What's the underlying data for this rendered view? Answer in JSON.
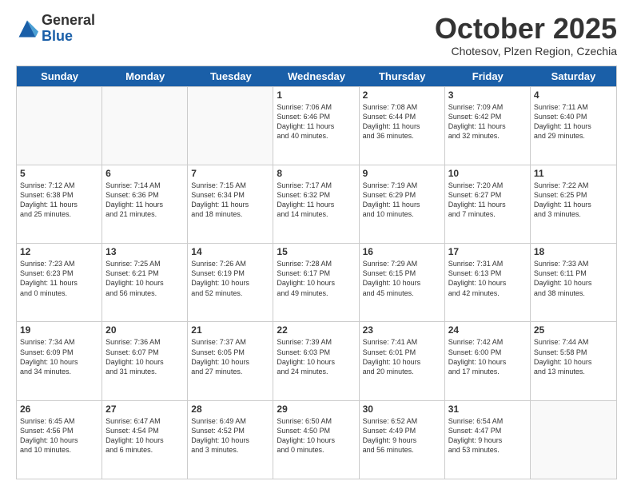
{
  "logo": {
    "general": "General",
    "blue": "Blue"
  },
  "header": {
    "month": "October 2025",
    "location": "Chotesov, Plzen Region, Czechia"
  },
  "weekdays": [
    "Sunday",
    "Monday",
    "Tuesday",
    "Wednesday",
    "Thursday",
    "Friday",
    "Saturday"
  ],
  "rows": [
    [
      {
        "day": "",
        "info": ""
      },
      {
        "day": "",
        "info": ""
      },
      {
        "day": "",
        "info": ""
      },
      {
        "day": "1",
        "info": "Sunrise: 7:06 AM\nSunset: 6:46 PM\nDaylight: 11 hours\nand 40 minutes."
      },
      {
        "day": "2",
        "info": "Sunrise: 7:08 AM\nSunset: 6:44 PM\nDaylight: 11 hours\nand 36 minutes."
      },
      {
        "day": "3",
        "info": "Sunrise: 7:09 AM\nSunset: 6:42 PM\nDaylight: 11 hours\nand 32 minutes."
      },
      {
        "day": "4",
        "info": "Sunrise: 7:11 AM\nSunset: 6:40 PM\nDaylight: 11 hours\nand 29 minutes."
      }
    ],
    [
      {
        "day": "5",
        "info": "Sunrise: 7:12 AM\nSunset: 6:38 PM\nDaylight: 11 hours\nand 25 minutes."
      },
      {
        "day": "6",
        "info": "Sunrise: 7:14 AM\nSunset: 6:36 PM\nDaylight: 11 hours\nand 21 minutes."
      },
      {
        "day": "7",
        "info": "Sunrise: 7:15 AM\nSunset: 6:34 PM\nDaylight: 11 hours\nand 18 minutes."
      },
      {
        "day": "8",
        "info": "Sunrise: 7:17 AM\nSunset: 6:32 PM\nDaylight: 11 hours\nand 14 minutes."
      },
      {
        "day": "9",
        "info": "Sunrise: 7:19 AM\nSunset: 6:29 PM\nDaylight: 11 hours\nand 10 minutes."
      },
      {
        "day": "10",
        "info": "Sunrise: 7:20 AM\nSunset: 6:27 PM\nDaylight: 11 hours\nand 7 minutes."
      },
      {
        "day": "11",
        "info": "Sunrise: 7:22 AM\nSunset: 6:25 PM\nDaylight: 11 hours\nand 3 minutes."
      }
    ],
    [
      {
        "day": "12",
        "info": "Sunrise: 7:23 AM\nSunset: 6:23 PM\nDaylight: 11 hours\nand 0 minutes."
      },
      {
        "day": "13",
        "info": "Sunrise: 7:25 AM\nSunset: 6:21 PM\nDaylight: 10 hours\nand 56 minutes."
      },
      {
        "day": "14",
        "info": "Sunrise: 7:26 AM\nSunset: 6:19 PM\nDaylight: 10 hours\nand 52 minutes."
      },
      {
        "day": "15",
        "info": "Sunrise: 7:28 AM\nSunset: 6:17 PM\nDaylight: 10 hours\nand 49 minutes."
      },
      {
        "day": "16",
        "info": "Sunrise: 7:29 AM\nSunset: 6:15 PM\nDaylight: 10 hours\nand 45 minutes."
      },
      {
        "day": "17",
        "info": "Sunrise: 7:31 AM\nSunset: 6:13 PM\nDaylight: 10 hours\nand 42 minutes."
      },
      {
        "day": "18",
        "info": "Sunrise: 7:33 AM\nSunset: 6:11 PM\nDaylight: 10 hours\nand 38 minutes."
      }
    ],
    [
      {
        "day": "19",
        "info": "Sunrise: 7:34 AM\nSunset: 6:09 PM\nDaylight: 10 hours\nand 34 minutes."
      },
      {
        "day": "20",
        "info": "Sunrise: 7:36 AM\nSunset: 6:07 PM\nDaylight: 10 hours\nand 31 minutes."
      },
      {
        "day": "21",
        "info": "Sunrise: 7:37 AM\nSunset: 6:05 PM\nDaylight: 10 hours\nand 27 minutes."
      },
      {
        "day": "22",
        "info": "Sunrise: 7:39 AM\nSunset: 6:03 PM\nDaylight: 10 hours\nand 24 minutes."
      },
      {
        "day": "23",
        "info": "Sunrise: 7:41 AM\nSunset: 6:01 PM\nDaylight: 10 hours\nand 20 minutes."
      },
      {
        "day": "24",
        "info": "Sunrise: 7:42 AM\nSunset: 6:00 PM\nDaylight: 10 hours\nand 17 minutes."
      },
      {
        "day": "25",
        "info": "Sunrise: 7:44 AM\nSunset: 5:58 PM\nDaylight: 10 hours\nand 13 minutes."
      }
    ],
    [
      {
        "day": "26",
        "info": "Sunrise: 6:45 AM\nSunset: 4:56 PM\nDaylight: 10 hours\nand 10 minutes."
      },
      {
        "day": "27",
        "info": "Sunrise: 6:47 AM\nSunset: 4:54 PM\nDaylight: 10 hours\nand 6 minutes."
      },
      {
        "day": "28",
        "info": "Sunrise: 6:49 AM\nSunset: 4:52 PM\nDaylight: 10 hours\nand 3 minutes."
      },
      {
        "day": "29",
        "info": "Sunrise: 6:50 AM\nSunset: 4:50 PM\nDaylight: 10 hours\nand 0 minutes."
      },
      {
        "day": "30",
        "info": "Sunrise: 6:52 AM\nSunset: 4:49 PM\nDaylight: 9 hours\nand 56 minutes."
      },
      {
        "day": "31",
        "info": "Sunrise: 6:54 AM\nSunset: 4:47 PM\nDaylight: 9 hours\nand 53 minutes."
      },
      {
        "day": "",
        "info": ""
      }
    ]
  ]
}
